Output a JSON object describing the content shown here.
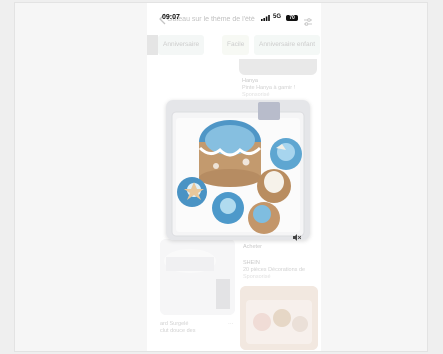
{
  "status_bar": {
    "time": "09:07",
    "network": "5G",
    "battery": "70"
  },
  "header": {
    "title": "Gâteau sur le thème de l'été",
    "back_icon": "chevron-left-icon",
    "settings_icon": "sliders-icon"
  },
  "chips": [
    "Anniversaire",
    "Facile",
    "Anniversaire enfant"
  ],
  "feed": {
    "top_right": {
      "title": "Hanya",
      "subtitle": "Pinte Hanya à garnir !",
      "meta": "Sponsorisé"
    },
    "right_mid": {
      "action": "Acheter",
      "brand": "SHEIN",
      "subtitle": "20 pièces Décorations de",
      "meta": "Sponsorisé"
    },
    "bottom_left": {
      "line1": "ard Surgelé",
      "line2": "clut douce des",
      "more": "···"
    }
  },
  "main_photo": {
    "subject": "cupcake-box",
    "mute_icon": "speaker-muted-icon"
  },
  "colors": {
    "frosting": "#5a9ec9",
    "box": "#f4f4f4",
    "sand": "#c9a27a"
  }
}
